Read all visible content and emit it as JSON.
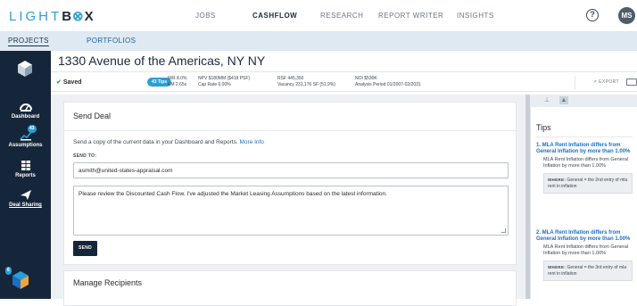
{
  "nav": {
    "logo_light": "LIGHT",
    "logo_box": "B",
    "logo_x": "X",
    "items": [
      "JOBS",
      "CASHFLOW",
      "RESEARCH",
      "REPORT WRITER",
      "INSIGHTS"
    ],
    "active_item": "CASHFLOW",
    "help_label": "?",
    "avatar_initials": "MS"
  },
  "subnav": {
    "tabs": [
      "PROJECTS",
      "PORTFOLIOS"
    ],
    "active_tab": "PROJECTS"
  },
  "sidebar": {
    "items": [
      {
        "label": "Dashboard",
        "icon": "gauge-icon"
      },
      {
        "label": "Assumptions",
        "icon": "chart-edit-icon",
        "badge": "43"
      },
      {
        "label": "Reports",
        "icon": "reports-icon"
      },
      {
        "label": "Deal Sharing",
        "icon": "send-icon"
      }
    ],
    "bottom_badge": "6"
  },
  "header": {
    "title": "1330 Avenue of the Americas, NY NY",
    "saved_label": "Saved",
    "tips_pill": "43 Tips",
    "metrics": {
      "irr": "IRR 8.0%",
      "em": "EM 2.65x",
      "npv": "NPV $180MM ($418 PSF)",
      "cap_rate": "Cap Rate 6.00%",
      "rsf": "RSF 445,350",
      "vacancy": "Vacancy 231,176 SF (51.9%)",
      "noi": "NOI $530K",
      "analysis_period": "Analysis Period 01/2007-02/2031"
    },
    "export_label": "EXPORT"
  },
  "send_deal": {
    "title": "Send Deal",
    "description": "Send a copy of the current data in your Dashboard and Reports.",
    "more_info": "More Info",
    "send_to_label": "SEND TO:",
    "email_value": "asmith@united-states-appraisal.com",
    "message_value": "Please review the Discounted Cash Flow.  I've adjusted the Market Leasing Assumptions based on the latest information.",
    "send_button": "SEND"
  },
  "manage": {
    "title": "Manage Recipients"
  },
  "tips": {
    "title": "Tips",
    "items": [
      {
        "head": "1. MLA Rent Inflation differs from General Inflation by more than 1.00%",
        "body": "MLA Rent Inflation differs from General Inflation by more than 1.00%",
        "where_label": "WHERE:",
        "where_text": "General = the 2nd entry of mla rent in inflation"
      },
      {
        "head": "2. MLA Rent Inflation differs from General Inflation by more than 1.00%",
        "body": "MLA Rent Inflation differs from General Inflation by more than 1.00%",
        "where_label": "WHERE:",
        "where_text": "General = the 3rd entry of mla rent in inflation"
      }
    ]
  },
  "colors": {
    "accent": "#2a9fd6",
    "sidebar": "#16263a",
    "link": "#1b6fc2"
  }
}
